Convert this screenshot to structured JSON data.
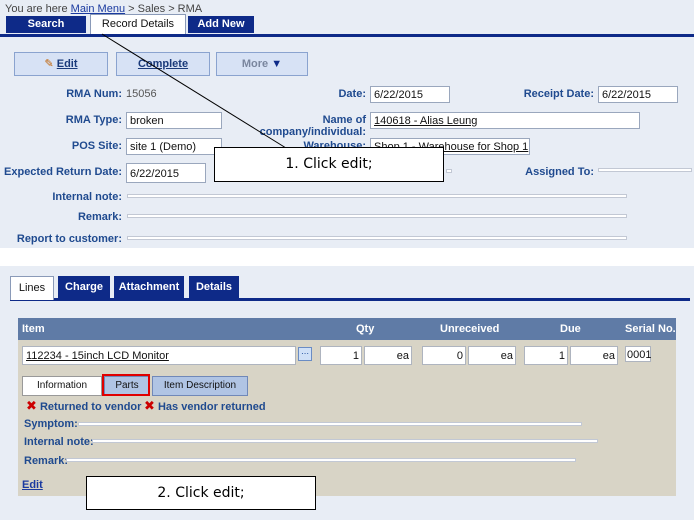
{
  "breadcrumb": {
    "prefix": "You are here",
    "main_menu": "Main Menu",
    "rest": "> Sales > RMA"
  },
  "top_tabs": {
    "search": "Search",
    "record_details": "Record Details",
    "add_new": "Add New"
  },
  "toolbar": {
    "edit": "Edit",
    "complete": "Complete",
    "more": "More"
  },
  "form": {
    "rma_num_label": "RMA Num:",
    "rma_num_value": "15056",
    "date_label": "Date:",
    "date_value": "6/22/2015",
    "receipt_date_label": "Receipt Date:",
    "receipt_date_value": "6/22/2015",
    "rma_type_label": "RMA Type:",
    "rma_type_value": "broken",
    "company_label": "Name of company/individual:",
    "company_value": "140618 - Alias Leung",
    "pos_site_label": "POS Site:",
    "pos_site_value": "site 1 (Demo)",
    "warehouse_label": "Warehouse:",
    "warehouse_value": "Shop 1 - Warehouse for Shop 1",
    "expected_return_label": "Expected Return Date:",
    "expected_return_value": "6/22/2015",
    "assigned_to_label": "Assigned To:",
    "internal_note_label": "Internal note:",
    "remark_label": "Remark:",
    "report_label": "Report to customer:"
  },
  "callouts": {
    "first": "1.    Click edit;",
    "second": "2.    Click edit;"
  },
  "lower_tabs": {
    "lines": "Lines",
    "charge": "Charge",
    "attachment": "Attachment",
    "details": "Details"
  },
  "grid": {
    "headers": {
      "item": "Item",
      "qty": "Qty",
      "unreceived": "Unreceived",
      "due": "Due",
      "serial": "Serial No."
    },
    "row": {
      "item": "112234 - 15inch LCD Monitor",
      "qty": "1",
      "qty_unit": "ea",
      "unreceived": "0",
      "unreceived_unit": "ea",
      "due": "1",
      "due_unit": "ea",
      "serial": "0001"
    }
  },
  "sub_tabs": {
    "information": "Information",
    "parts": "Parts",
    "item_description": "Item Description"
  },
  "checks": {
    "returned_to_vendor": "Returned to vendor",
    "has_vendor_returned": "Has vendor returned"
  },
  "lower_form": {
    "symptom_label": "Symptom:",
    "internal_note_label": "Internal note:",
    "remark_label": "Remark:",
    "edit_link": "Edit"
  },
  "colors": {
    "nav_dark": "#0e2a88",
    "panel_bg": "#e8edf5",
    "grid_header": "#5f7ba6",
    "grid_body": "#d8d4c6",
    "highlight": "#e00000"
  }
}
